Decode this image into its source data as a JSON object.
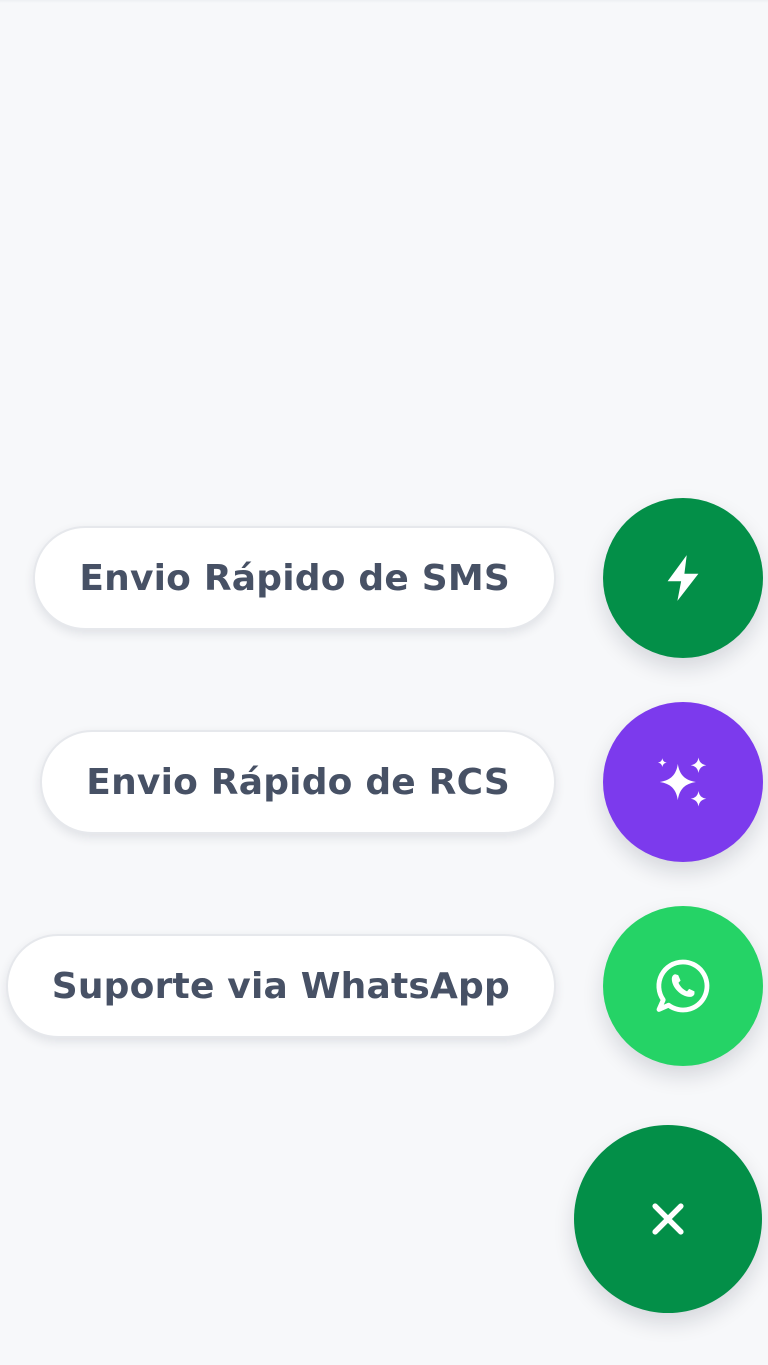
{
  "quick_actions": {
    "items": [
      {
        "label": "Envio Rápido de SMS",
        "icon": "lightning-bolt-icon",
        "color": "#038f48"
      },
      {
        "label": "Envio Rápido de RCS",
        "icon": "sparkles-icon",
        "color": "#7c3aed"
      },
      {
        "label": "Suporte via WhatsApp",
        "icon": "whatsapp-icon",
        "color": "#25d366"
      }
    ],
    "toggle": {
      "icon": "close-icon",
      "color": "#038f48"
    }
  },
  "colors": {
    "background": "#f7f8fa",
    "label_text": "#475165",
    "label_background": "#ffffff"
  }
}
